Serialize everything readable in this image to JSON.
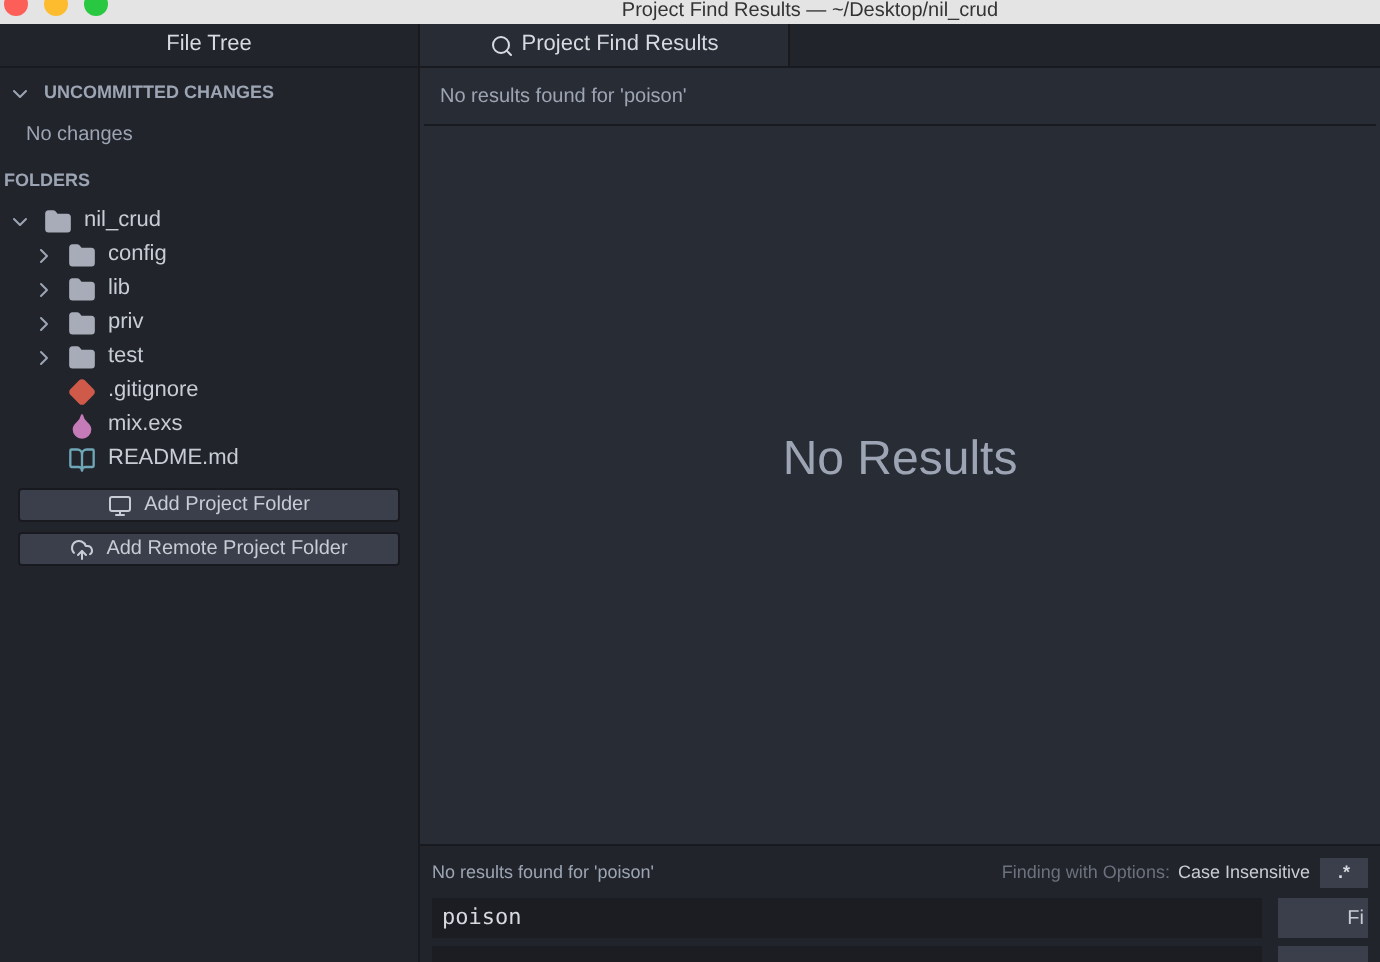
{
  "window": {
    "title": "Project Find Results — ~/Desktop/nil_crud"
  },
  "sidebar": {
    "title": "File Tree",
    "sections": [
      {
        "label": "UNCOMMITTED CHANGES",
        "expanded": true,
        "note": "No changes"
      }
    ],
    "folders_label": "FOLDERS",
    "tree": [
      {
        "name": "nil_crud",
        "kind": "repo",
        "expanded": true,
        "children": [
          {
            "name": "config",
            "kind": "folder",
            "expanded": false
          },
          {
            "name": "lib",
            "kind": "folder",
            "expanded": false
          },
          {
            "name": "priv",
            "kind": "folder",
            "expanded": false
          },
          {
            "name": "test",
            "kind": "folder",
            "expanded": false
          },
          {
            "name": ".gitignore",
            "kind": "git"
          },
          {
            "name": "mix.exs",
            "kind": "drop"
          },
          {
            "name": "README.md",
            "kind": "book"
          }
        ]
      }
    ],
    "buttons": [
      {
        "label": "Add Project Folder",
        "kind": "monitor"
      },
      {
        "label": "Add Remote Project Folder",
        "kind": "cloud"
      }
    ]
  },
  "tabs": [
    {
      "label": "Project Find Results",
      "selected": true
    }
  ],
  "results": {
    "summary": "No results found for 'poison'",
    "empty": "No Results"
  },
  "find_panel": {
    "message": "No results found for 'poison'",
    "options_label": "Finding with Options:",
    "options_value": "Case Insensitive",
    "regex_button": ".*",
    "query": "poison",
    "find_button": "Fi"
  }
}
